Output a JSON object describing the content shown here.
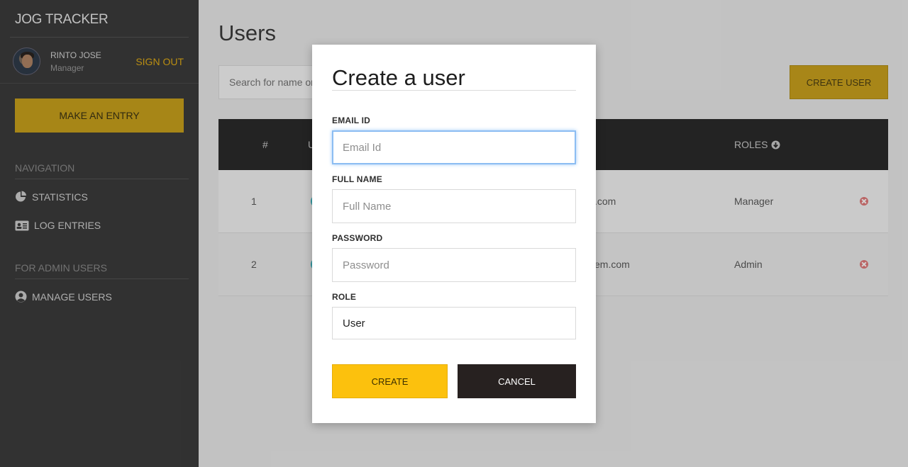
{
  "sidebar": {
    "brand": "JOG TRACKER",
    "user_name": "RINTO JOSE",
    "user_role": "Manager",
    "sign_out": "SIGN OUT",
    "entry_button": "MAKE AN ENTRY",
    "nav_title": "NAVIGATION",
    "nav_items": [
      {
        "label": "STATISTICS",
        "icon": "pie-chart-icon"
      },
      {
        "label": "LOG ENTRIES",
        "icon": "id-card-icon"
      }
    ],
    "admin_title": "FOR ADMIN USERS",
    "admin_items": [
      {
        "label": "MANAGE USERS",
        "icon": "user-circle-icon"
      }
    ]
  },
  "main": {
    "title": "Users",
    "search_placeholder": "Search for name or",
    "create_user_button": "CREATE USER",
    "table": {
      "headers": {
        "index": "#",
        "user": "U",
        "roles": "ROLES"
      },
      "rows": [
        {
          "index": "1",
          "email_fragment": ".com",
          "role": "Manager"
        },
        {
          "index": "2",
          "email_fragment": "em.com",
          "role": "Admin"
        }
      ]
    }
  },
  "modal": {
    "title": "Create a user",
    "email": {
      "label": "EMAIL ID",
      "placeholder": "Email Id",
      "value": ""
    },
    "full_name": {
      "label": "FULL NAME",
      "placeholder": "Full Name",
      "value": ""
    },
    "password": {
      "label": "PASSWORD",
      "placeholder": "Password",
      "value": ""
    },
    "role": {
      "label": "ROLE",
      "value": "User"
    },
    "create_button": "CREATE",
    "cancel_button": "CANCEL"
  },
  "colors": {
    "accent": "#fcc10d",
    "sidebar_bg": "#3c3c3c",
    "table_header_bg": "#2b2b2b",
    "cancel_bg": "#272120",
    "focus_ring": "#8cbdf2"
  }
}
